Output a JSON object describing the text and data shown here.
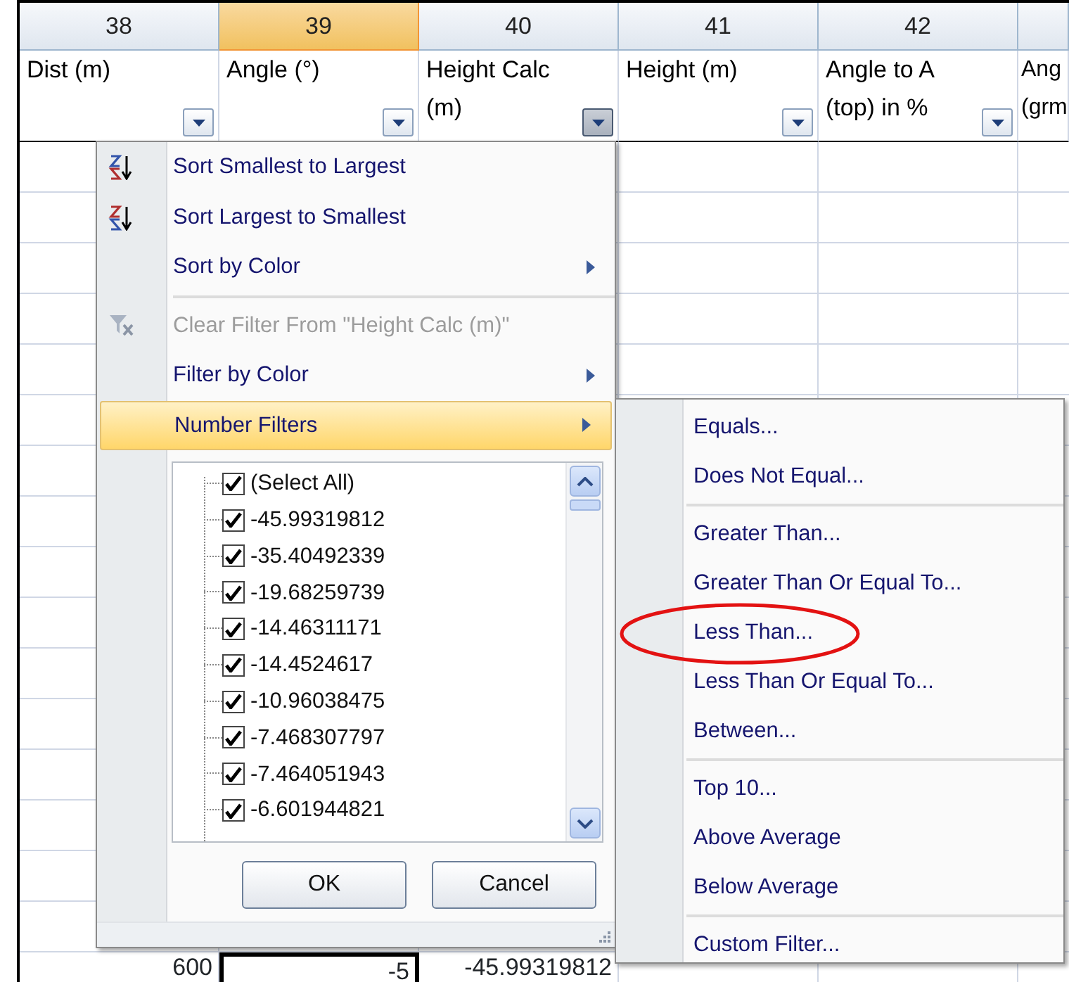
{
  "columns": [
    {
      "number": "38",
      "selected": false,
      "header": "Dist (m)",
      "filter_open": false
    },
    {
      "number": "39",
      "selected": true,
      "header": "Angle (°)",
      "filter_open": false
    },
    {
      "number": "40",
      "selected": false,
      "header": "Height Calc (m)",
      "filter_open": true
    },
    {
      "number": "41",
      "selected": false,
      "header": "Height (m)",
      "filter_open": false
    },
    {
      "number": "42",
      "selected": false,
      "header": "Angle to A (top) in %",
      "filter_open": false
    }
  ],
  "cut_column": {
    "header": "Ang (grm"
  },
  "visible_row": [
    {
      "value": "600",
      "selected": false
    },
    {
      "value": "-5",
      "selected": true
    },
    {
      "value": "-45.99319812",
      "selected": false
    }
  ],
  "filter_menu": {
    "items": [
      {
        "kind": "sortup",
        "label": "Sort Smallest to Largest",
        "disabled": false,
        "submenu": false,
        "selected": false
      },
      {
        "kind": "sortdown",
        "label": "Sort Largest to Smallest",
        "disabled": false,
        "submenu": false,
        "selected": false
      },
      {
        "kind": "item",
        "label": "Sort by Color",
        "disabled": false,
        "submenu": true,
        "selected": false
      },
      {
        "kind": "separator"
      },
      {
        "kind": "clear",
        "label": "Clear Filter From \"Height Calc (m)\"",
        "disabled": true,
        "submenu": false,
        "selected": false
      },
      {
        "kind": "item",
        "label": "Filter by Color",
        "disabled": false,
        "submenu": true,
        "selected": false
      },
      {
        "kind": "item",
        "label": "Number Filters",
        "disabled": false,
        "submenu": true,
        "selected": true
      }
    ],
    "values": [
      {
        "label": "(Select All)",
        "checked": true
      },
      {
        "label": "-45.99319812",
        "checked": true
      },
      {
        "label": "-35.40492339",
        "checked": true
      },
      {
        "label": "-19.68259739",
        "checked": true
      },
      {
        "label": "-14.46311171",
        "checked": true
      },
      {
        "label": "-14.4524617",
        "checked": true
      },
      {
        "label": "-10.96038475",
        "checked": true
      },
      {
        "label": "-7.468307797",
        "checked": true
      },
      {
        "label": "-7.464051943",
        "checked": true
      },
      {
        "label": "-6.601944821",
        "checked": true
      }
    ],
    "buttons": [
      "OK",
      "Cancel"
    ]
  },
  "number_filters_menu": [
    {
      "kind": "item",
      "label": "Equals...",
      "circled": false
    },
    {
      "kind": "item",
      "label": "Does Not Equal...",
      "circled": false
    },
    {
      "kind": "separator"
    },
    {
      "kind": "item",
      "label": "Greater Than...",
      "circled": false
    },
    {
      "kind": "item",
      "label": "Greater Than Or Equal To...",
      "circled": false
    },
    {
      "kind": "item",
      "label": "Less Than...",
      "circled": true
    },
    {
      "kind": "item",
      "label": "Less Than Or Equal To...",
      "circled": false
    },
    {
      "kind": "item",
      "label": "Between...",
      "circled": false
    },
    {
      "kind": "separator"
    },
    {
      "kind": "item",
      "label": "Top 10...",
      "circled": false
    },
    {
      "kind": "item",
      "label": "Above Average",
      "circled": false
    },
    {
      "kind": "item",
      "label": "Below Average",
      "circled": false
    },
    {
      "kind": "separator"
    },
    {
      "kind": "item",
      "label": "Custom Filter...",
      "circled": false
    }
  ]
}
